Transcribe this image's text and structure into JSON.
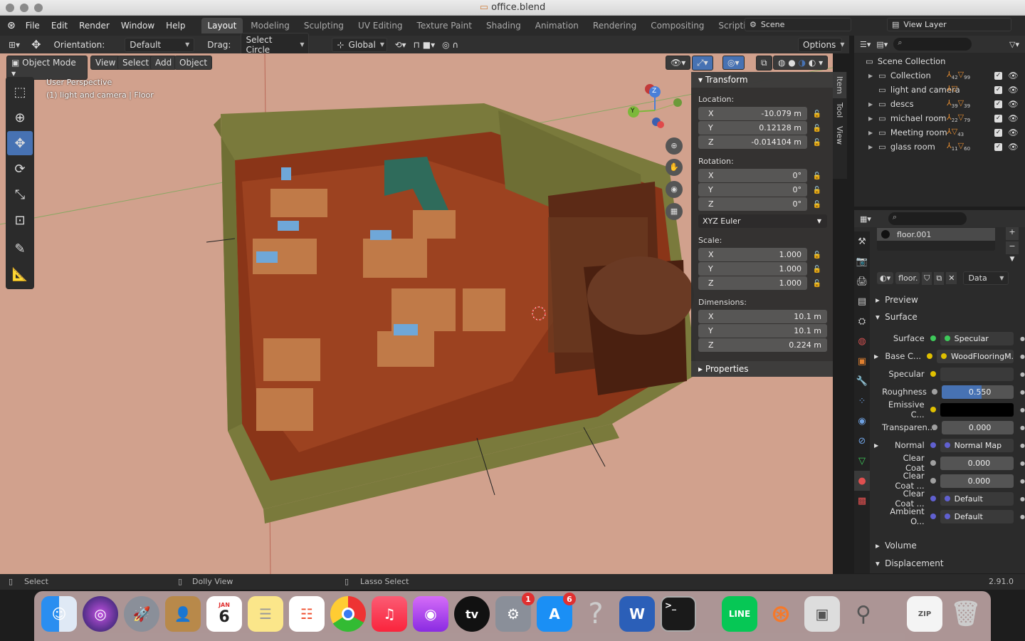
{
  "window": {
    "title": "office.blend"
  },
  "menubar": {
    "items": [
      "File",
      "Edit",
      "Render",
      "Window",
      "Help"
    ],
    "workspaces": [
      "Layout",
      "Modeling",
      "Sculpting",
      "UV Editing",
      "Texture Paint",
      "Shading",
      "Animation",
      "Rendering",
      "Compositing",
      "Scripting"
    ],
    "add_tab": "+",
    "scene": "Scene",
    "view_layer": "View Layer"
  },
  "header": {
    "orientation_label": "Orientation:",
    "orientation_value": "Default",
    "drag_label": "Drag:",
    "drag_value": "Select Circle",
    "transform_space": "Global",
    "options": "Options"
  },
  "viewport_header": {
    "mode": "Object Mode",
    "menus": [
      "View",
      "Select",
      "Add",
      "Object"
    ]
  },
  "viewport": {
    "overlay_line1": "User Perspective",
    "overlay_line2": "(1) light and camera | Floor",
    "gizmo": {
      "z": "Z",
      "y": "Y"
    }
  },
  "npanel": {
    "tabs": [
      "Item",
      "Tool",
      "View"
    ],
    "transform_title": "Transform",
    "location_label": "Location:",
    "location": [
      {
        "axis": "X",
        "value": "-10.079 m"
      },
      {
        "axis": "Y",
        "value": "0.12128 m"
      },
      {
        "axis": "Z",
        "value": "-0.014104 m"
      }
    ],
    "rotation_label": "Rotation:",
    "rotation": [
      {
        "axis": "X",
        "value": "0°"
      },
      {
        "axis": "Y",
        "value": "0°"
      },
      {
        "axis": "Z",
        "value": "0°"
      }
    ],
    "rotation_mode": "XYZ Euler",
    "scale_label": "Scale:",
    "scale": [
      {
        "axis": "X",
        "value": "1.000"
      },
      {
        "axis": "Y",
        "value": "1.000"
      },
      {
        "axis": "Z",
        "value": "1.000"
      }
    ],
    "dimensions_label": "Dimensions:",
    "dimensions": [
      {
        "axis": "X",
        "value": "10.1 m"
      },
      {
        "axis": "Y",
        "value": "10.1 m"
      },
      {
        "axis": "Z",
        "value": "0.224 m"
      }
    ],
    "properties_title": "Properties"
  },
  "outliner": {
    "root": "Scene Collection",
    "items": [
      {
        "name": "Collection",
        "n1": "42",
        "n2": "99"
      },
      {
        "name": "light and camera",
        "n1": "",
        "n2": ""
      },
      {
        "name": "descs",
        "n1": "39",
        "n2": "39"
      },
      {
        "name": "michael room",
        "n1": "22",
        "n2": "79"
      },
      {
        "name": "Meeting room",
        "n1": "",
        "n2": "43"
      },
      {
        "name": "glass room",
        "n1": "11",
        "n2": "60"
      }
    ]
  },
  "properties": {
    "material_slot": "floor.001",
    "material_name": "floor.",
    "link_mode": "Data",
    "sections": {
      "preview": "Preview",
      "surface": "Surface",
      "volume": "Volume",
      "displacement": "Displacement"
    },
    "surface_rows": [
      {
        "label": "Surface",
        "value": "Specular",
        "socket": "#3ec95a",
        "kind": "link"
      },
      {
        "label": "Base C...",
        "value": "WoodFlooringM...",
        "socket": "#e0c000",
        "kind": "link",
        "expand": true
      },
      {
        "label": "Specular",
        "value": "",
        "socket": "#e0c000",
        "kind": "color"
      },
      {
        "label": "Roughness",
        "value": "0.550",
        "socket": "#a0a0a0",
        "kind": "slider",
        "fill": 0.55
      },
      {
        "label": "Emissive C...",
        "value": "",
        "socket": "#e0c000",
        "kind": "black"
      },
      {
        "label": "Transparen...",
        "value": "0.000",
        "socket": "#a0a0a0",
        "kind": "num"
      },
      {
        "label": "Normal",
        "value": "Normal Map",
        "socket": "#6060d0",
        "kind": "link",
        "expand": true
      },
      {
        "label": "Clear Coat",
        "value": "0.000",
        "socket": "#a0a0a0",
        "kind": "num"
      },
      {
        "label": "Clear Coat ...",
        "value": "0.000",
        "socket": "#a0a0a0",
        "kind": "num"
      },
      {
        "label": "Clear Coat ...",
        "value": "Default",
        "socket": "#6060d0",
        "kind": "link"
      },
      {
        "label": "Ambient O...",
        "value": "Default",
        "socket": "#6060d0",
        "kind": "link"
      }
    ]
  },
  "statusbar": {
    "select": "Select",
    "dolly": "Dolly View",
    "lasso": "Lasso Select",
    "version": "2.91.0"
  },
  "dock": {
    "calendar_month": "JAN",
    "calendar_day": "6",
    "prefs_badge": "1",
    "appstore_badge": "6",
    "tv_label": "tv",
    "line_label": "LINE",
    "word_label": "W",
    "help_glyph": "?"
  }
}
